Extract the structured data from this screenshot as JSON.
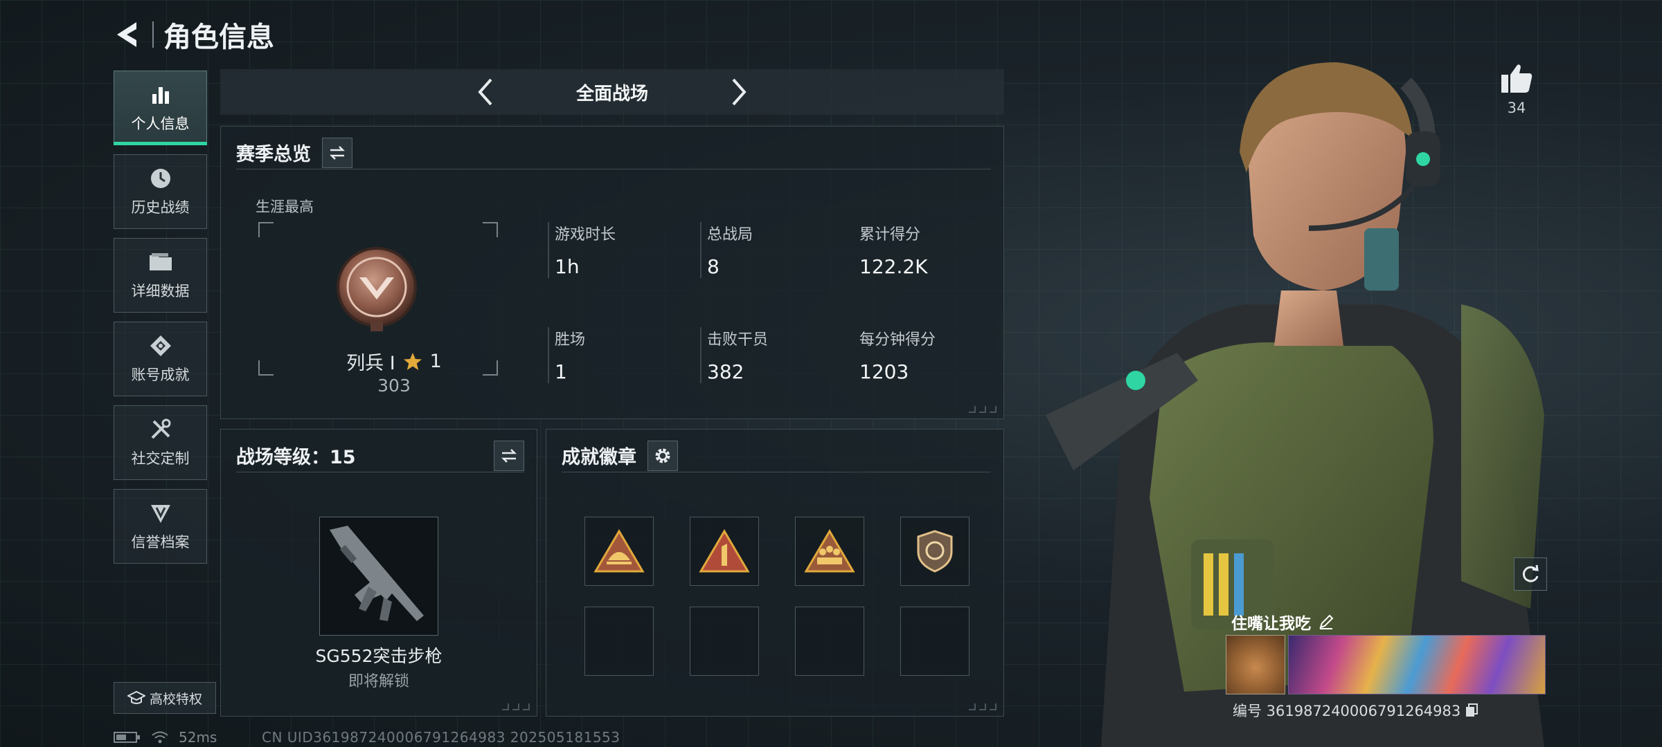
{
  "header": {
    "title": "角色信息"
  },
  "sidebar": {
    "items": [
      {
        "label": "个人信息",
        "icon": "bar-chart-icon",
        "active": true
      },
      {
        "label": "历史战绩",
        "icon": "clock-icon"
      },
      {
        "label": "详细数据",
        "icon": "folder-icon"
      },
      {
        "label": "账号成就",
        "icon": "achievement-icon"
      },
      {
        "label": "社交定制",
        "icon": "tools-icon"
      },
      {
        "label": "信誉档案",
        "icon": "reputation-icon"
      }
    ],
    "campus_label": "高校特权"
  },
  "mode": {
    "title": "全面战场"
  },
  "season": {
    "title": "赛季总览",
    "career_label": "生涯最高",
    "rank_name": "列兵 Ⅰ",
    "rank_stars": "1",
    "rank_score": "303",
    "stats": [
      {
        "label": "游戏时长",
        "value": "1h"
      },
      {
        "label": "总战局",
        "value": "8"
      },
      {
        "label": "累计得分",
        "value": "122.2K"
      },
      {
        "label": "胜场",
        "value": "1"
      },
      {
        "label": "击败干员",
        "value": "382"
      },
      {
        "label": "每分钟得分",
        "value": "1203"
      }
    ]
  },
  "battle_level": {
    "title": "战场等级：15",
    "weapon_name": "SG552突击步枪",
    "weapon_status": "即将解锁"
  },
  "achievements": {
    "title": "成就徽章"
  },
  "status": {
    "latency": "52ms",
    "uid": "CN UID3619872400067912649​83 202505181553"
  },
  "profile": {
    "likes": "34",
    "name": "住嘴让我吃",
    "id_label": "编号 3619872400067912649​83"
  },
  "colors": {
    "accent": "#2fd6a3",
    "gold": "#e2a93b",
    "panel": "#182126"
  }
}
